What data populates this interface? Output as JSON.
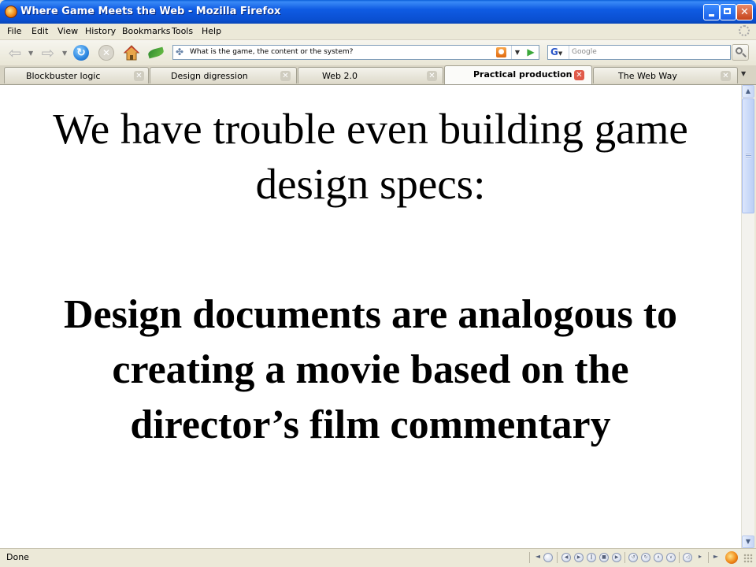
{
  "window": {
    "title": "Where Game Meets the Web - Mozilla Firefox"
  },
  "menu": {
    "items": [
      "File",
      "Edit",
      "View",
      "History",
      "Bookmarks",
      "Tools",
      "Help"
    ]
  },
  "navbar": {
    "url": "What is the game, the content or the system?",
    "search_placeholder": "Google",
    "search_engine_glyph": "G",
    "icons": [
      "back-arrow-icon",
      "forward-arrow-icon",
      "reload-icon",
      "stop-icon",
      "home-icon",
      "leaf-icon",
      "feed-icon",
      "go-arrow-icon",
      "magnifier-icon"
    ]
  },
  "tabs": [
    {
      "label": "Blockbuster logic",
      "active": false
    },
    {
      "label": "Design digression",
      "active": false
    },
    {
      "label": "Web 2.0",
      "active": false
    },
    {
      "label": "Practical production",
      "active": true
    },
    {
      "label": "The Web Way",
      "active": false
    }
  ],
  "slide": {
    "intro_lines": [
      "We have trouble even building game",
      "design specs:"
    ],
    "point_lines": [
      "Design documents are analogous to",
      "creating a movie based on the",
      "director’s film commentary"
    ]
  },
  "status": {
    "text": "Done"
  },
  "colors": {
    "titlebar": "#0a4fd0",
    "chrome": "#ece9d8",
    "active_tab_close": "#e05a4a"
  }
}
